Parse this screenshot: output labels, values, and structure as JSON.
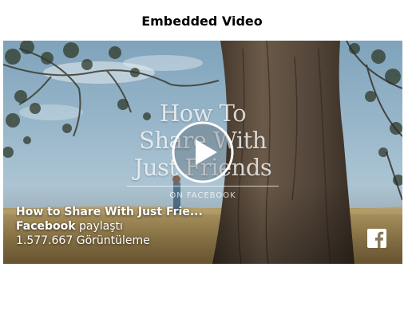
{
  "page": {
    "title": "Embedded Video"
  },
  "video": {
    "thumbnail_text_lines": [
      "How To",
      "Share With",
      "Just Friends"
    ],
    "thumbnail_subtitle": "ON FACEBOOK",
    "title": "How to Share With Just Frie...",
    "publisher": "Facebook",
    "shared_text": "paylaştı",
    "views_count": "1.577.667",
    "views_label": "Görüntüleme",
    "play_icon": "play-icon",
    "brand_icon": "facebook-logo-icon"
  },
  "colors": {
    "sky": "#8fb0c4",
    "field": "#b79a5e",
    "trunk": "#5a4a3a",
    "facebook_icon": "#ffffff"
  }
}
